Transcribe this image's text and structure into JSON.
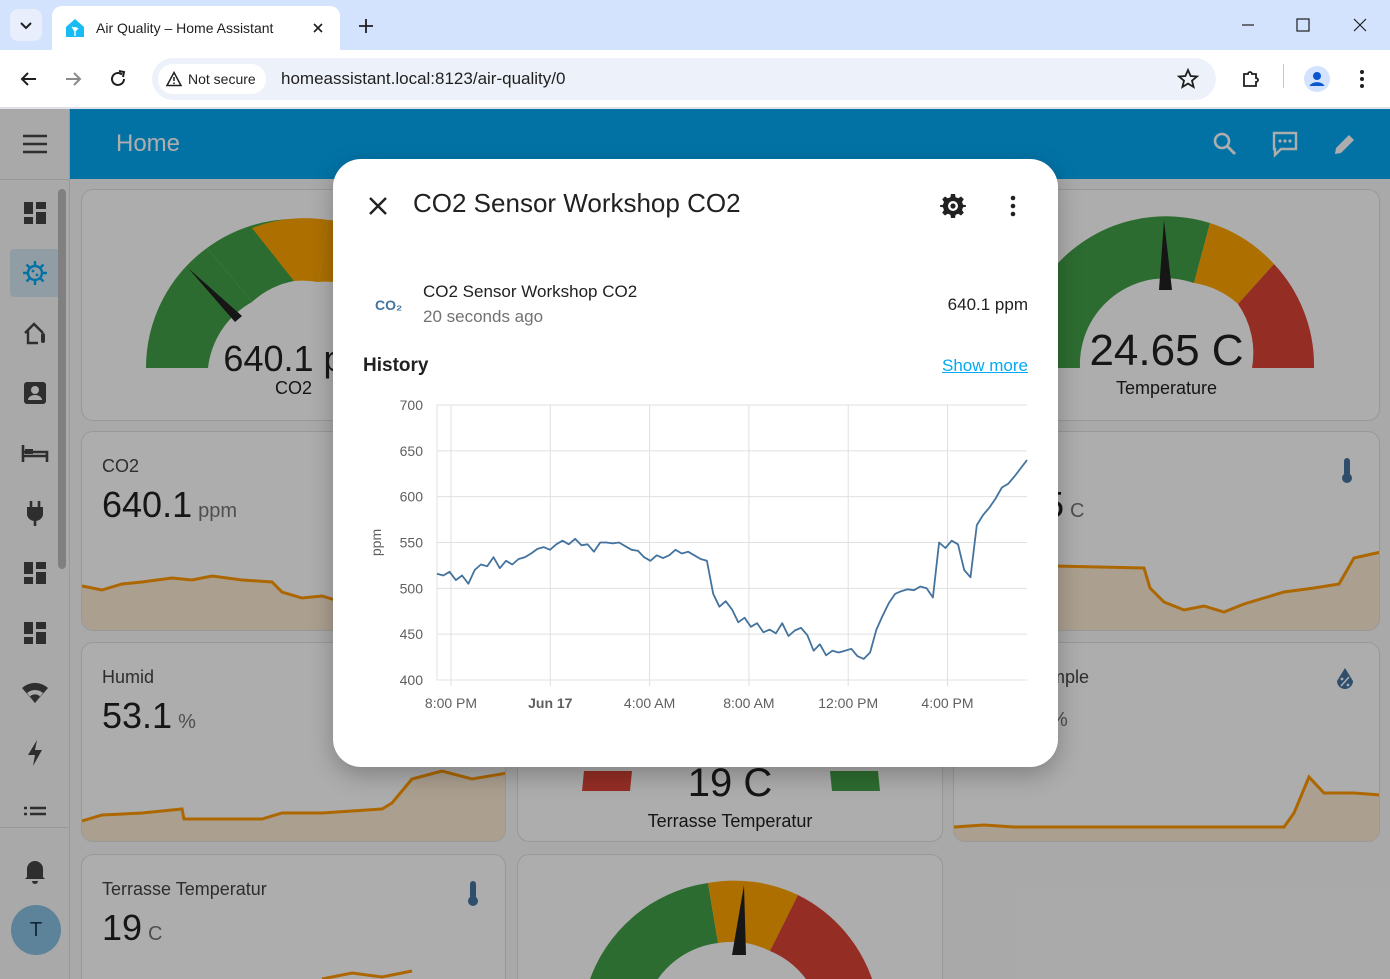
{
  "browser": {
    "tab_title": "Air Quality – Home Assistant",
    "security_label": "Not secure",
    "url": "homeassistant.local:8123/air-quality/0"
  },
  "ha": {
    "appbar_title": "Home",
    "avatar_initial": "T",
    "cards": {
      "gauge_co2": {
        "value": "640.1 pp",
        "name": "CO2"
      },
      "gauge_temp": {
        "value": "24.65 C",
        "name": "Temperature"
      },
      "sensor_co2": {
        "name": "CO2",
        "value": "640.1",
        "unit": "ppm"
      },
      "sensor_temp_partial": {
        "value": "5",
        "unit": "C"
      },
      "sensor_humid": {
        "name": "Humid",
        "value": "53.1",
        "unit": "%"
      },
      "sensor_gauge_terrasse": {
        "value": "19 C",
        "name": "Terrasse Temperatur"
      },
      "sensor_mple": {
        "name": "mple",
        "unit": "%"
      },
      "sensor_terrasse": {
        "name": "Terrasse Temperatur",
        "value": "19",
        "unit": "C"
      }
    }
  },
  "dialog": {
    "title": "CO2 Sensor Workshop CO2",
    "entity_icon_text": "CO₂",
    "entity_name": "CO2 Sensor Workshop CO2",
    "entity_time": "20 seconds ago",
    "entity_state": "640.1 ppm",
    "history_title": "History",
    "show_more": "Show more"
  },
  "colors": {
    "ha_primary": "#03a9f4",
    "line": "#44739e",
    "gauge_green": "#43a047",
    "gauge_yellow": "#ffa600",
    "gauge_red": "#db4437",
    "sparkline": "#ff9800"
  },
  "chart_data": {
    "type": "line",
    "ylabel": "ppm",
    "ylim": [
      400,
      700
    ],
    "yticks": [
      "700",
      "650",
      "600",
      "550",
      "500",
      "450",
      "400"
    ],
    "xticks": [
      "8:00 PM",
      "Jun 17",
      "4:00 AM",
      "8:00 AM",
      "12:00 PM",
      "4:00 PM"
    ],
    "grid": true,
    "series": [
      {
        "values": [
          516,
          514,
          518,
          509,
          514,
          505,
          520,
          526,
          524,
          534,
          522,
          530,
          526,
          532,
          534,
          538,
          543,
          545,
          542,
          548,
          552,
          548,
          554,
          547,
          548,
          540,
          550,
          550,
          549,
          550,
          546,
          542,
          541,
          534,
          530,
          536,
          533,
          536,
          542,
          538,
          540,
          536,
          532,
          530,
          494,
          480,
          486,
          477,
          463,
          468,
          458,
          462,
          452,
          455,
          451,
          462,
          448,
          454,
          457,
          449,
          432,
          439,
          427,
          432,
          430,
          432,
          434,
          426,
          423,
          430,
          455,
          470,
          484,
          494,
          497,
          499,
          498,
          502,
          500,
          490,
          550,
          544,
          552,
          548,
          520,
          512,
          569,
          580,
          588,
          598,
          610,
          614,
          622,
          631,
          640
        ]
      }
    ]
  }
}
